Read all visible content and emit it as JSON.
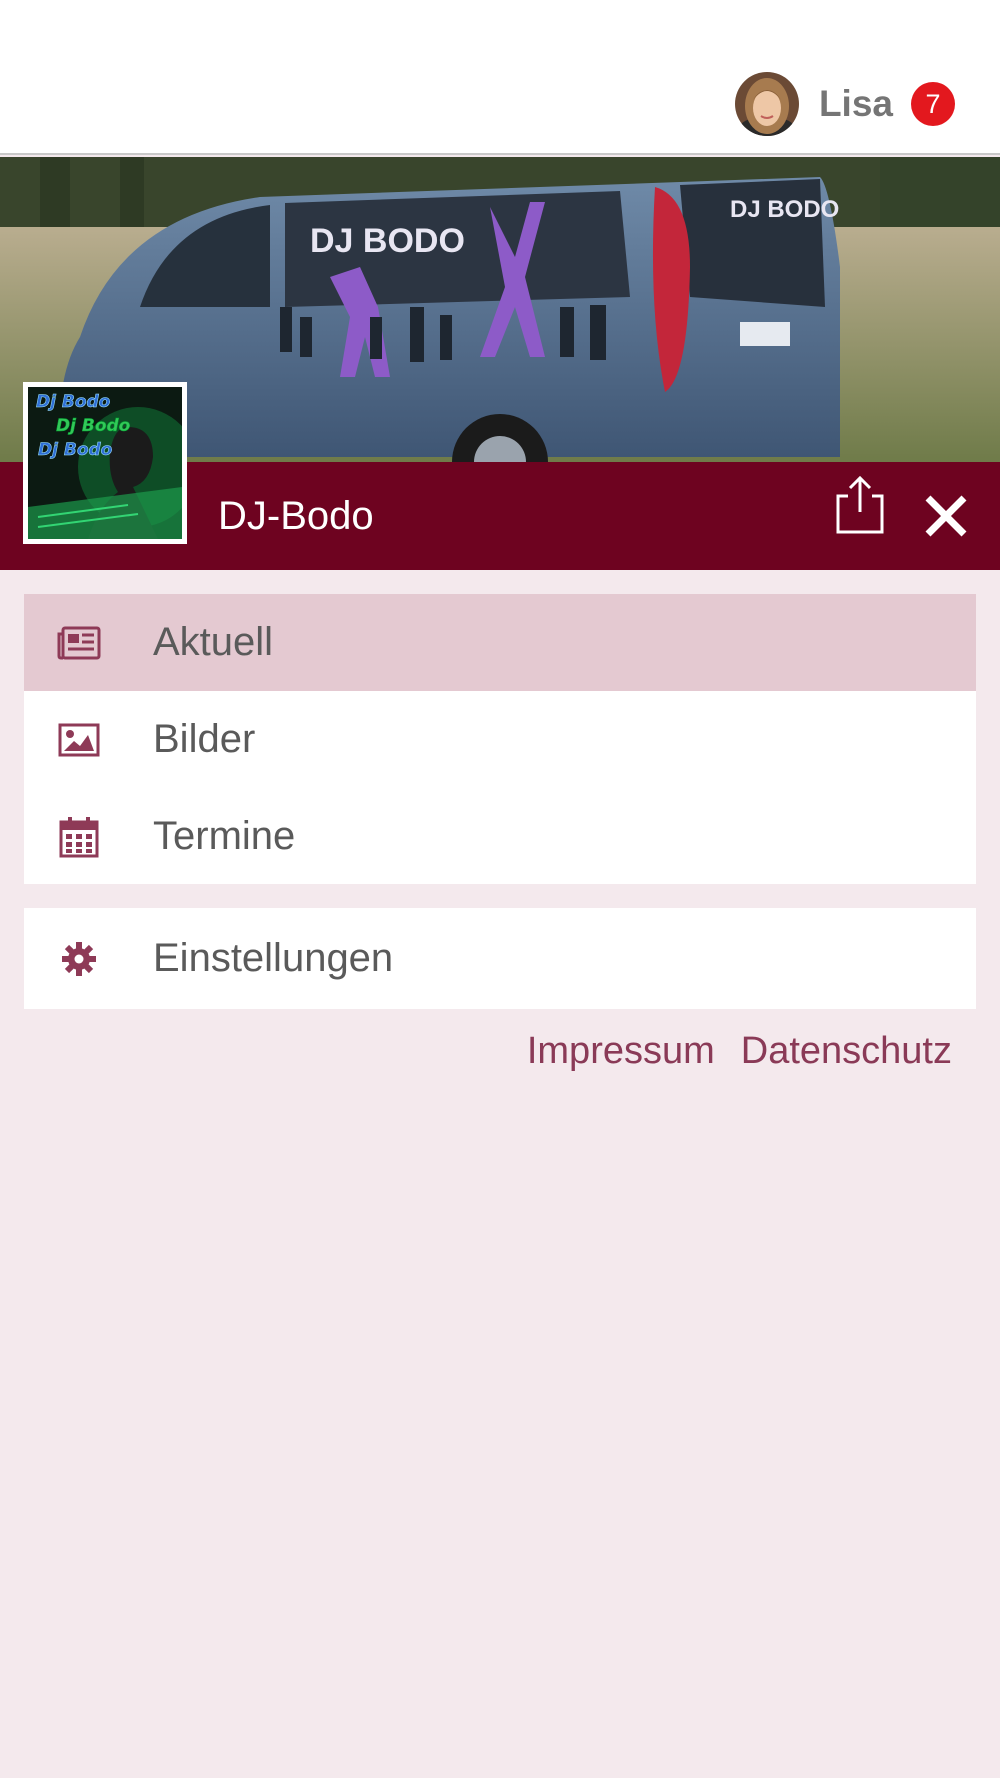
{
  "user": {
    "name": "Lisa",
    "notification_count": "7"
  },
  "page": {
    "title": "DJ-Bodo"
  },
  "logo": {
    "lines": [
      "Dj Bodo",
      "Dj Bodo",
      "Dj Bodo"
    ]
  },
  "cover": {
    "van_lettering": "DJ BODO"
  },
  "menu": {
    "items": [
      {
        "label": "Aktuell",
        "icon": "newspaper-icon",
        "active": true
      },
      {
        "label": "Bilder",
        "icon": "image-icon",
        "active": false
      },
      {
        "label": "Termine",
        "icon": "calendar-icon",
        "active": false
      }
    ],
    "settings": {
      "label": "Einstellungen",
      "icon": "gear-icon"
    }
  },
  "footer": {
    "impressum": "Impressum",
    "datenschutz": "Datenschutz"
  },
  "colors": {
    "brand": "#6e0320",
    "background": "#f4e9ed",
    "active_item": "#e4c9d1",
    "icon": "#8e3a57",
    "badge": "#e3181e"
  }
}
